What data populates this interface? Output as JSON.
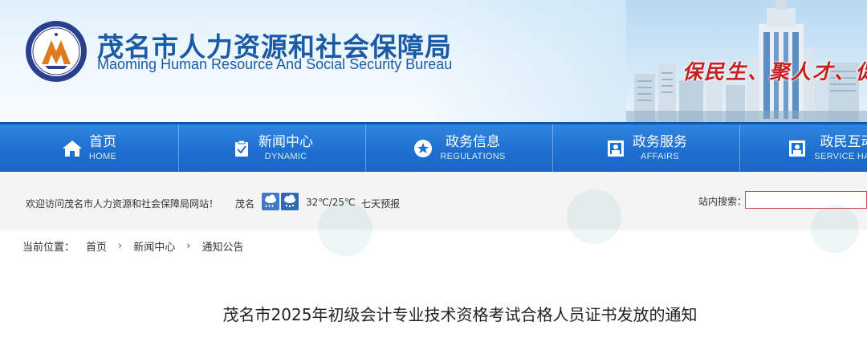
{
  "header": {
    "title_cn": "茂名市人力资源和社会保障局",
    "title_en": "Maoming Human Resource And Social Security Bureau",
    "slogan": "保民生、聚人才、促发",
    "emblem_icon": "bureau-emblem-icon",
    "brand_color": "#1b5aa6",
    "slogan_color": "#c8201e"
  },
  "nav": {
    "items": [
      {
        "label": "首页",
        "sub": "HOME",
        "icon": "home-icon"
      },
      {
        "label": "新闻中心",
        "sub": "DYNAMIC",
        "icon": "clipboard-check-icon"
      },
      {
        "label": "政务信息",
        "sub": "REGULATIONS",
        "icon": "star-circle-icon"
      },
      {
        "label": "政务服务",
        "sub": "AFFAIRS",
        "icon": "service-window-icon"
      },
      {
        "label": "政民互动",
        "sub": "SERVICE HALL",
        "icon": "service-window-icon"
      }
    ],
    "bar_color": "#1f6fd0"
  },
  "infobar": {
    "welcome": "欢迎访问茂名市人力资源和社会保障局网站！",
    "city": "茂名",
    "weather_icons": [
      "rain-cloud-icon",
      "snow-cloud-icon"
    ],
    "temperature": "32℃/25℃",
    "forecast_link": "七天预报",
    "search_label": "站内搜索：",
    "search_value": ""
  },
  "breadcrumb": {
    "label": "当前位置：",
    "items": [
      "首页",
      "新闻中心",
      "通知公告"
    ],
    "separator": "›"
  },
  "article": {
    "title": "茂名市2025年初级会计专业技术资格考试合格人员证书发放的通知"
  }
}
